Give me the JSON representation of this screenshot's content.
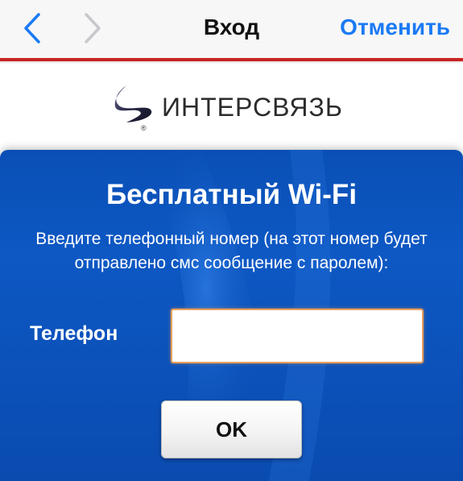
{
  "navbar": {
    "back_icon": "chevron-left-icon",
    "forward_icon": "chevron-right-icon",
    "title": "Вход",
    "cancel_label": "Отменить",
    "accent_color": "#c92323",
    "link_color": "#1a7af5"
  },
  "logo": {
    "text": "ИНТЕРСВЯЗЬ",
    "registered_mark": "®"
  },
  "form": {
    "title": "Бесплатный Wi-Fi",
    "description": "Введите телефонный номер (на этот номер будет отправлено смс сообщение с паролем):",
    "phone_label": "Телефон",
    "phone_value": "",
    "submit_label": "OK",
    "panel_color": "#0a4fb5",
    "input_focus_color": "#e8a05c"
  }
}
